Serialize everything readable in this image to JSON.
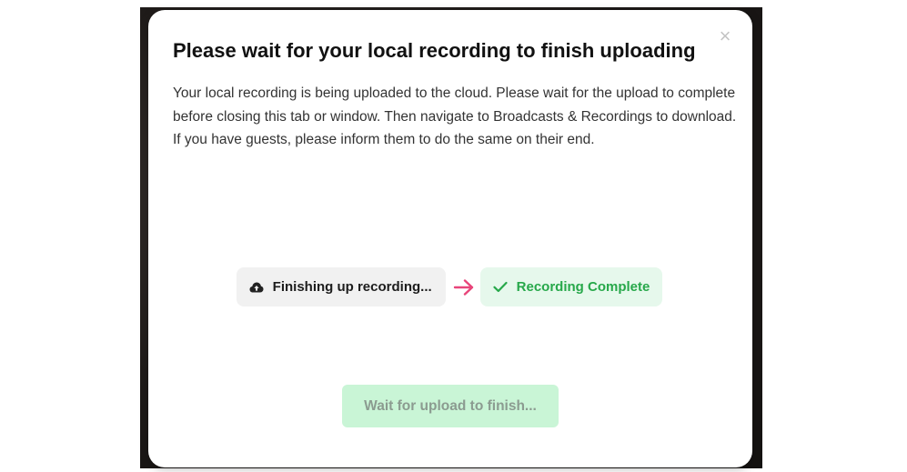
{
  "dialog": {
    "title": "Please wait for your local recording to finish uploading",
    "close_glyph": "×",
    "body": "Your local recording is being uploaded to the cloud. Please wait for the upload to complete before closing this tab or window. Then navigate to Broadcasts & Recordings to download. If you have guests, please inform them to do the same on their end."
  },
  "steps": {
    "pending": {
      "icon": "cloud-upload-icon",
      "label": "Finishing up recording..."
    },
    "arrow": {
      "icon": "arrow-right-icon",
      "color": "#e8457a"
    },
    "complete": {
      "icon": "checkmark-icon",
      "label": "Recording Complete",
      "color": "#27a84a"
    }
  },
  "footer": {
    "wait_button_label": "Wait for upload to finish...",
    "wait_button_state": "disabled"
  }
}
